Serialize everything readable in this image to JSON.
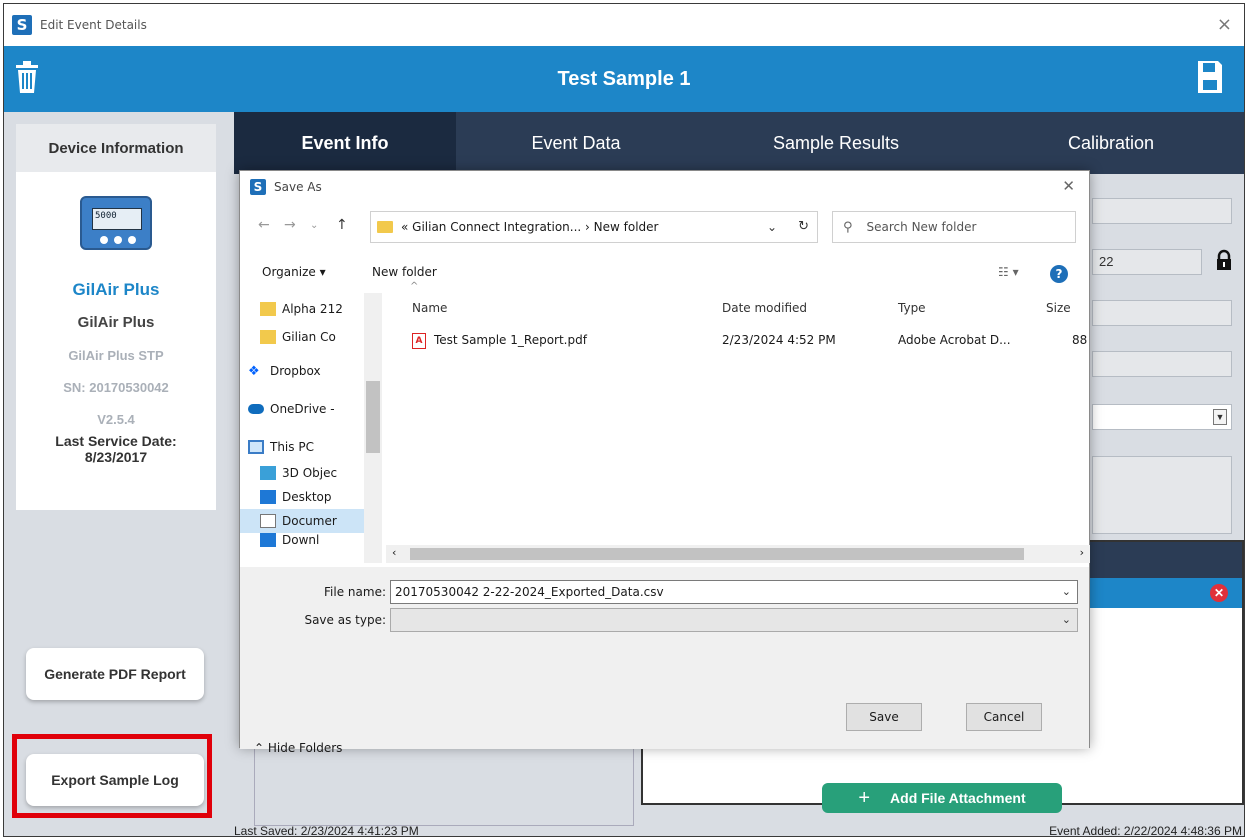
{
  "window": {
    "title": "Edit Event Details",
    "close": "×"
  },
  "header": {
    "title": "Test Sample 1"
  },
  "tabs": [
    "Event Info",
    "Event Data",
    "Sample Results",
    "Calibration"
  ],
  "device": {
    "heading": "Device Information",
    "screen_text": "5000",
    "brand": "GilAir Plus",
    "model": "GilAir Plus",
    "variant": "GilAir Plus STP",
    "serial": "SN: 20170530042",
    "version": "V2.5.4",
    "service_label": "Last Service Date:",
    "service_date": "8/23/2017"
  },
  "sidebar": {
    "generate_pdf": "Generate PDF Report",
    "export_log": "Export Sample Log"
  },
  "form": {
    "partial_value": "22"
  },
  "attachments": {
    "add_label": "Add File Attachment",
    "plus": "+",
    "remove": "✕"
  },
  "status": {
    "last_saved": "Last Saved: 2/23/2024 4:41:23 PM",
    "event_added": "Event Added: 2/22/2024 4:48:36 PM"
  },
  "save_dialog": {
    "title": "Save As",
    "path": "« Gilian Connect Integration...  ›  New folder",
    "search_placeholder": "Search New folder",
    "organize": "Organize ▾",
    "new_folder": "New folder",
    "nav": [
      "Alpha 212",
      "Gilian Co",
      "Dropbox",
      "OneDrive -",
      "This PC",
      "3D Objec",
      "Desktop",
      "Documer",
      "Downl"
    ],
    "columns": {
      "name": "Name",
      "date": "Date modified",
      "type": "Type",
      "size": "Size"
    },
    "files": [
      {
        "name": "Test Sample 1_Report.pdf",
        "date": "2/23/2024 4:52 PM",
        "type": "Adobe Acrobat D...",
        "size": "88"
      }
    ],
    "file_name_label": "File name:",
    "file_name_value": "20170530042 2-22-2024_Exported_Data.csv",
    "save_type_label": "Save as type:",
    "save_type_value": "",
    "hide_folders": "Hide Folders",
    "save": "Save",
    "cancel": "Cancel"
  },
  "colors": {
    "accent": "#1d86c8",
    "tabs_bg": "#2b3c55",
    "highlight": "#e0000a",
    "add_button": "#28a07a"
  }
}
